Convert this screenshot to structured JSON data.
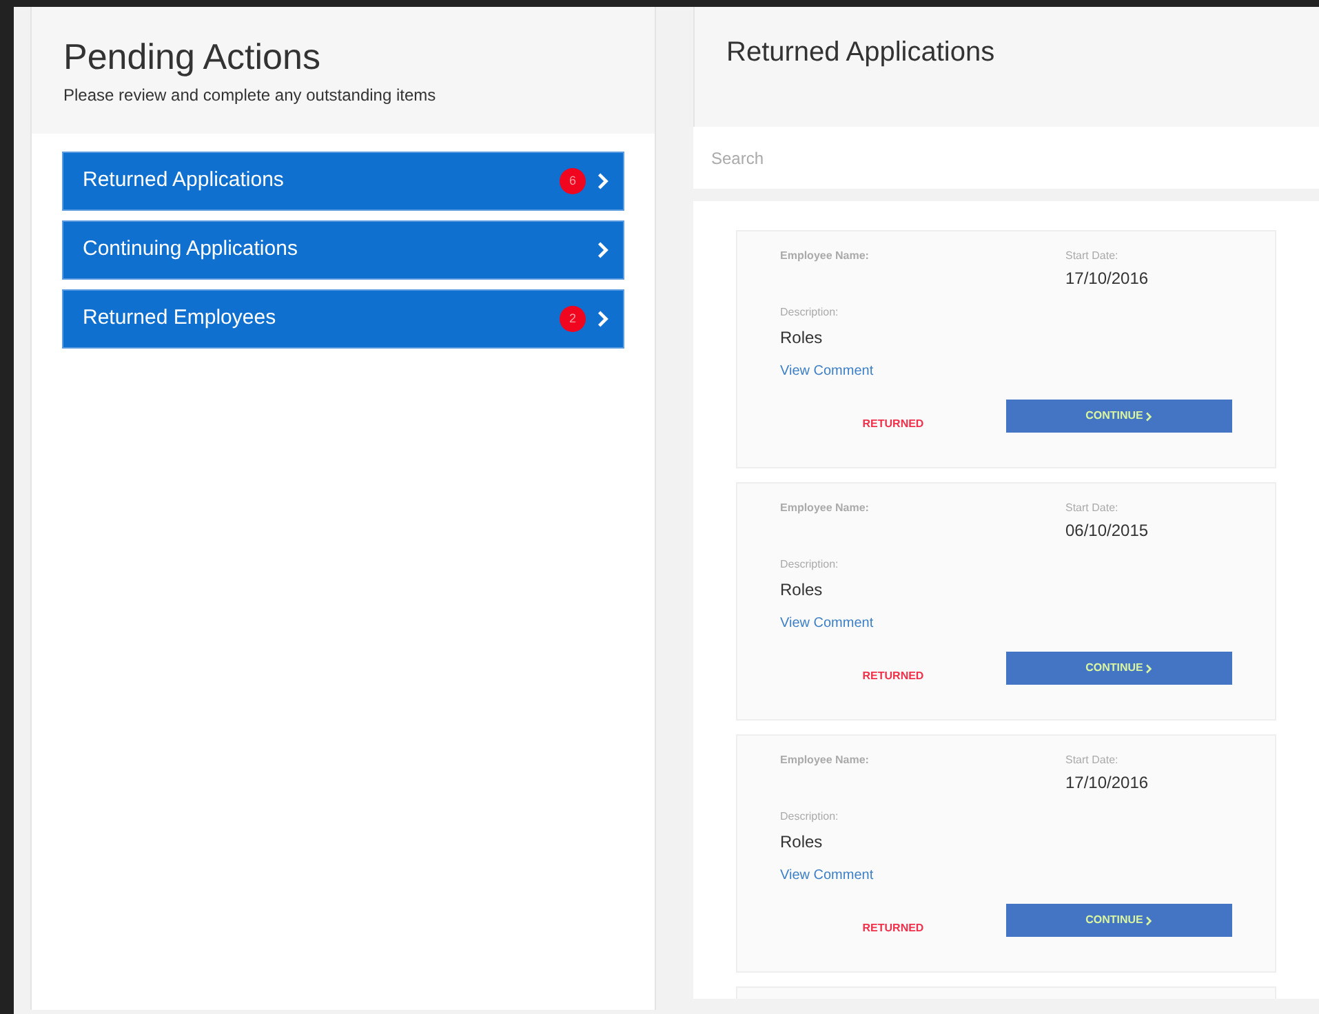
{
  "pending": {
    "title": "Pending Actions",
    "subtitle": "Please review and complete any outstanding items",
    "items": [
      {
        "label": "Returned Applications",
        "badge": "6"
      },
      {
        "label": "Continuing Applications"
      },
      {
        "label": "Returned Employees",
        "badge": "2"
      }
    ]
  },
  "returned": {
    "title": "Returned Applications",
    "search": {
      "placeholder": "Search"
    },
    "cards": [
      {
        "name_label": "Employee Name:",
        "date_label": "Start Date:",
        "date": "17/10/2016",
        "desc_label": "Description:",
        "desc": "Roles",
        "link": "View Comment",
        "status": "RETURNED",
        "button": "CONTINUE"
      },
      {
        "name_label": "Employee Name:",
        "date_label": "Start Date:",
        "date": "06/10/2015",
        "desc_label": "Description:",
        "desc": "Roles",
        "link": "View Comment",
        "status": "RETURNED",
        "button": "CONTINUE"
      },
      {
        "name_label": "Employee Name:",
        "date_label": "Start Date:",
        "date": "17/10/2016",
        "desc_label": "Description:",
        "desc": "Roles",
        "link": "View Comment",
        "status": "RETURNED",
        "button": "CONTINUE"
      }
    ]
  }
}
